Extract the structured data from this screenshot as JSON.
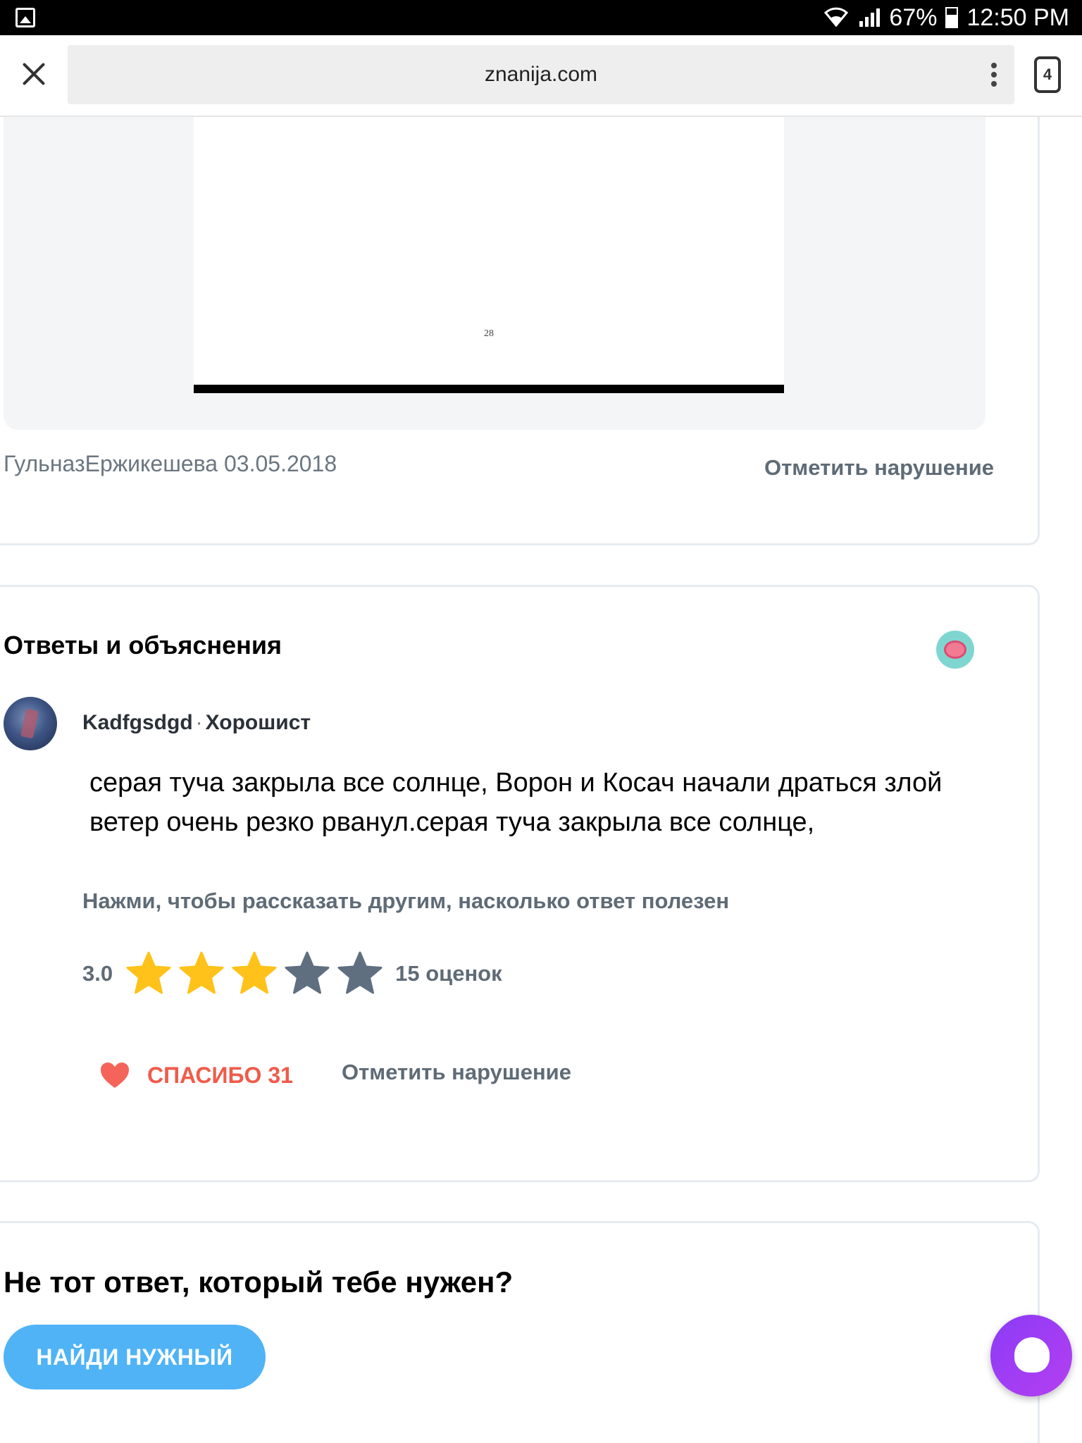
{
  "status_bar": {
    "battery": "67%",
    "time": "12:50 PM"
  },
  "browser": {
    "url": "znanija.com",
    "tab_count": "4"
  },
  "question": {
    "attachment_page_number": "28",
    "author_date": "ГульназЕржикешева 03.05.2018",
    "report_label": "Отметить нарушение"
  },
  "answers": {
    "title": "Ответы и объяснения",
    "answer": {
      "username": "Kadfgsdgd",
      "separator": "·",
      "rank": "Хорошист",
      "text": "серая туча закрыла все солнце, Ворон и Косач начали драться злой ветер очень резко рванул.серая туча закрыла все солнце,",
      "rate_hint": "Нажми, чтобы рассказать другим, насколько ответ полезен",
      "rating_value": "3.0",
      "stars_filled": 3,
      "stars_total": 5,
      "rating_count": "15 оценок",
      "thanks_label": "СПАСИБО 31",
      "report_label": "Отметить нарушение"
    }
  },
  "not_answer": {
    "title": "Не тот ответ, который тебе нужен?",
    "button_label": "НАЙДИ НУЖНЫЙ"
  },
  "colors": {
    "star_filled": "#ffc21a",
    "star_empty": "#5f6f80",
    "heart": "#f4645a",
    "thanks_text": "#ef5b4a",
    "find_button": "#4fb3f6",
    "fab": "#9b3df4"
  }
}
